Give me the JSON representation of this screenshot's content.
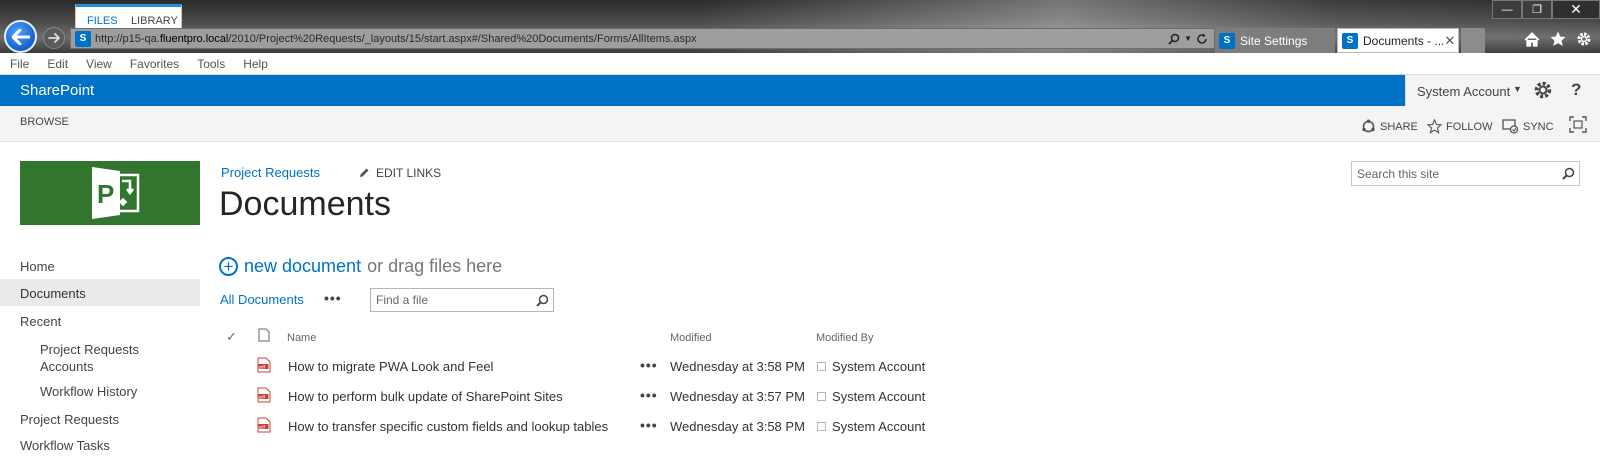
{
  "browser": {
    "address_url_prefix": "http://p15-qa.",
    "address_url_host": "fluentpro.local",
    "address_url_suffix": "/2010/Project%20Requests/_layouts/15/start.aspx#/Shared%20Documents/Forms/AllItems.aspx",
    "tabs": [
      {
        "label": "Site Settings",
        "active": false
      },
      {
        "label": "Documents - ...",
        "active": true
      }
    ],
    "favicon_letter": "S"
  },
  "menubar": {
    "items": [
      "File",
      "Edit",
      "View",
      "Favorites",
      "Tools",
      "Help"
    ]
  },
  "suitebar": {
    "brand": "SharePoint",
    "account": "System Account",
    "help_glyph": "?"
  },
  "ribbon": {
    "tabs": [
      "BROWSE",
      "FILES",
      "LIBRARY"
    ],
    "actions": {
      "share": "SHARE",
      "follow": "FOLLOW",
      "sync": "SYNC"
    }
  },
  "left_nav": {
    "items": [
      "Home",
      "Documents",
      "Recent",
      "Project Requests Accounts",
      "Workflow History",
      "Project Requests",
      "Workflow Tasks"
    ],
    "selected": "Documents"
  },
  "main": {
    "breadcrumb": "Project Requests",
    "edit_links": "EDIT LINKS",
    "title": "Documents",
    "site_search_placeholder": "Search this site",
    "new_document_link": "new document",
    "new_document_rest": "or drag files here",
    "view_name": "All Documents",
    "view_ellipsis": "•••",
    "find_file_placeholder": "Find a file"
  },
  "table": {
    "columns": [
      "Name",
      "Modified",
      "Modified By"
    ],
    "check_glyph": "✓",
    "rows": [
      {
        "name": "How to migrate PWA Look and Feel",
        "modified": "Wednesday at 3:58 PM",
        "modified_by": "System Account",
        "file_type": "pdf"
      },
      {
        "name": "How to perform bulk update of SharePoint Sites",
        "modified": "Wednesday at 3:57 PM",
        "modified_by": "System Account",
        "file_type": "pdf"
      },
      {
        "name": "How to transfer specific custom fields and lookup tables",
        "modified": "Wednesday at 3:58 PM",
        "modified_by": "System Account",
        "file_type": "pdf"
      }
    ]
  },
  "colors": {
    "suite_blue": "#0072c6",
    "logo_green": "#31752f",
    "link_blue": "#0072c6"
  }
}
